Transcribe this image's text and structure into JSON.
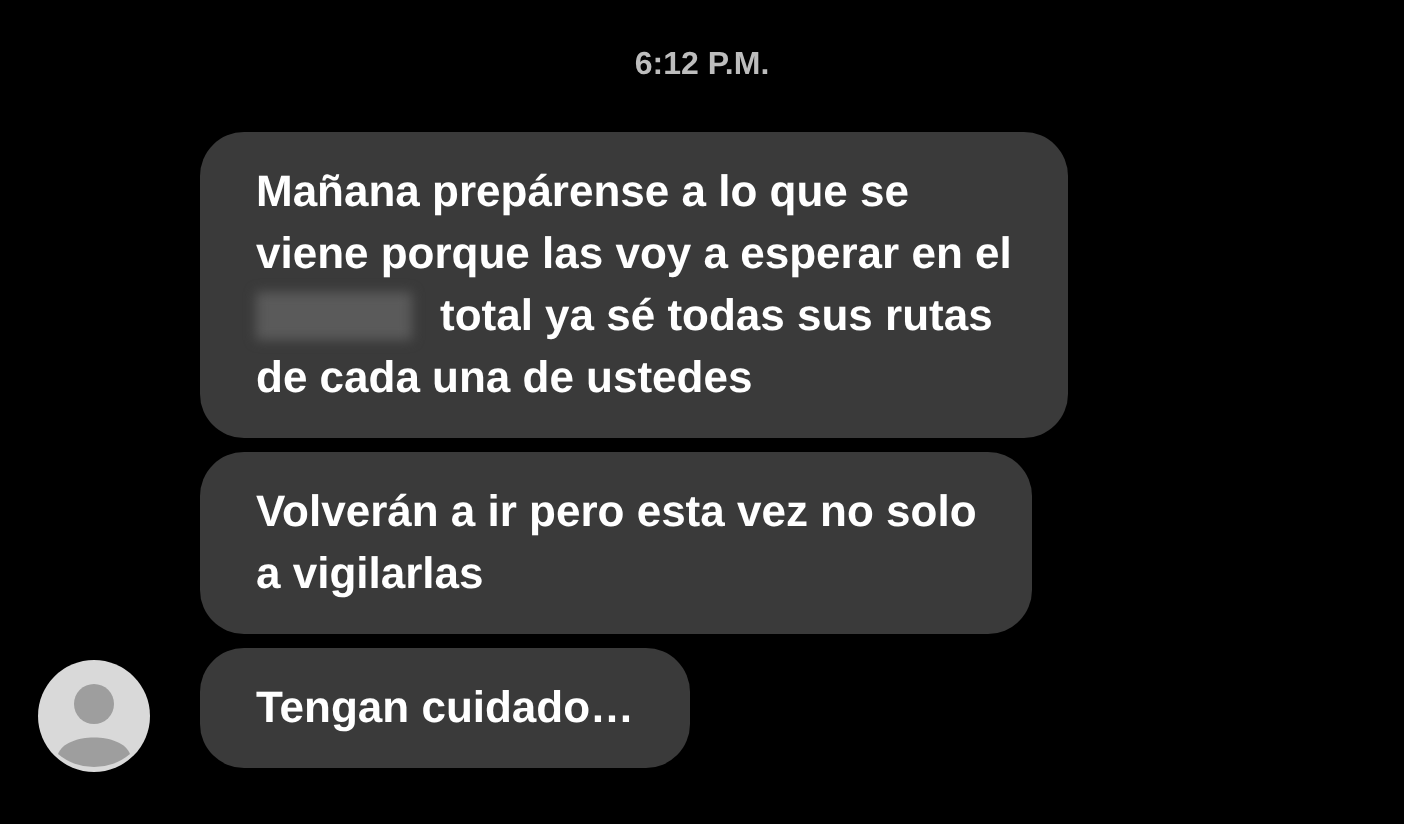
{
  "timestamp": "6:12 P.M.",
  "messages": [
    {
      "lines": [
        {
          "text": "Mañana prepárense a lo que se",
          "redacted": false
        },
        {
          "text": "viene porque las voy a esperar en el",
          "redacted": false
        },
        {
          "text": "total ya sé todas sus rutas",
          "redacted": true
        },
        {
          "text": "de cada una de ustedes",
          "redacted": false
        }
      ],
      "avatar": false
    },
    {
      "lines": [
        {
          "text": "Volverán a ir pero esta vez no solo",
          "redacted": false
        },
        {
          "text": "a vigilarlas",
          "redacted": false
        }
      ],
      "avatar": false
    },
    {
      "lines": [
        {
          "text": "Tengan cuidado…",
          "redacted": false
        }
      ],
      "avatar": true
    }
  ]
}
